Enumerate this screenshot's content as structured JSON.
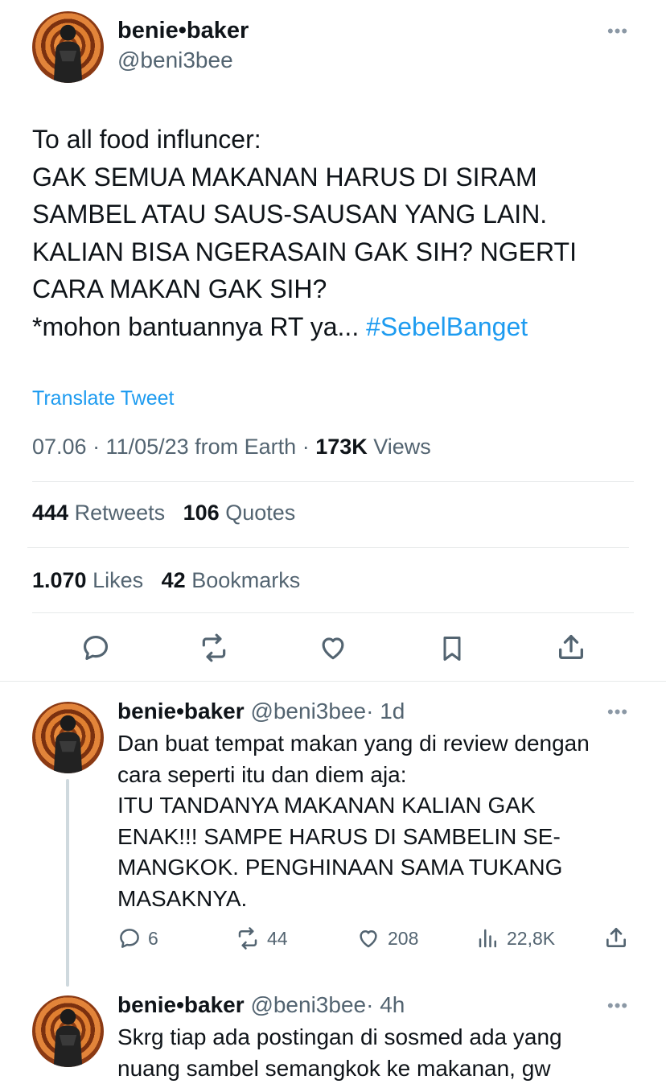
{
  "main_tweet": {
    "author_name": "benie•baker",
    "author_handle": "@beni3bee",
    "more_label": "•••",
    "text_lines": [
      "To all food influncer:",
      "GAK SEMUA MAKANAN HARUS DI SIRAM",
      "SAMBEL ATAU SAUS-SAUSAN YANG LAIN.",
      "KALIAN BISA NGERASAIN GAK SIH? NGERTI",
      "CARA MAKAN GAK SIH?",
      "*mohon bantuannya RT ya..."
    ],
    "hashtag": "#SebelBanget",
    "translate_label": "Translate Tweet",
    "meta": "07.06 · 11/05/23 from Earth · ",
    "views_count": "173K",
    "views_label": " Views",
    "retweets_count": "444",
    "retweets_label": " Retweets",
    "quotes_count": "106",
    "quotes_label": " Quotes",
    "likes_count": "1.070",
    "likes_label": " Likes",
    "bookmarks_count": "42",
    "bookmarks_label": " Bookmarks"
  },
  "replies": [
    {
      "author_name": "benie•baker",
      "author_handle": "@beni3bee",
      "time": "· 1d",
      "more_label": "•••",
      "text_lines": [
        "Dan buat tempat makan yang di review dengan",
        "cara seperti itu dan diem aja:",
        "ITU TANDANYA MAKANAN KALIAN GAK",
        "ENAK!!! SAMPE HARUS DI SAMBELIN SE-",
        "MANGKOK. PENGHINAAN SAMA TUKANG",
        "MASAKNYA."
      ],
      "reply_count": "6",
      "retweet_count": "44",
      "like_count": "208",
      "view_count": "22,8K"
    },
    {
      "author_name": "benie•baker",
      "author_handle": "@beni3bee",
      "time": "· 4h",
      "more_label": "•••",
      "text_lines": [
        "Skrg tiap ada postingan di sosmed ada yang",
        "nuang sambel semangkok ke makanan, gw"
      ]
    }
  ]
}
